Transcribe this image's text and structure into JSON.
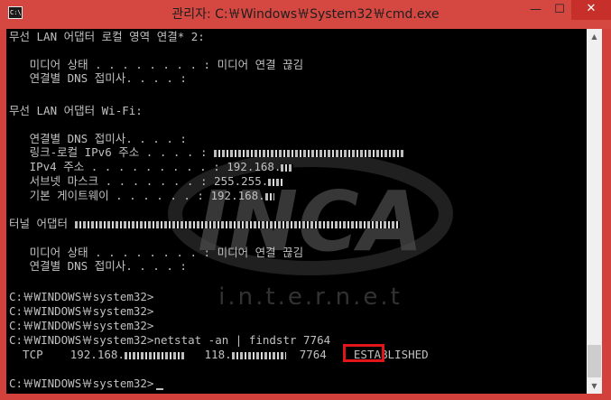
{
  "window": {
    "title": "관리자: C:￦Windows￦System32￦cmd.exe",
    "icon_label": "C:\\",
    "controls": {
      "minimize": "—",
      "maximize": "☐",
      "close": "✕"
    }
  },
  "console": {
    "lines": [
      "무선 LAN 어댑터 로컬 영역 연결* 2:",
      "",
      "   미디어 상태 . . . . . . . . : 미디어 연결 끊김",
      "   연결별 DNS 접미사. . . . :",
      "",
      "무선 LAN 어댑터 Wi-Fi:",
      "",
      "   연결별 DNS 접미사. . . . :",
      "   링크-로컬 IPv6 주소 . . . . :",
      "   IPv4 주소 . . . . . . . . . : 192.168.",
      "   서브넷 마스크 . . . . . . . : 255.255.",
      "   기본 게이트웨이 . . . . . . : 192.168.",
      "",
      "터널 어댑터",
      "",
      "   미디어 상태 . . . . . . . . : 미디어 연결 끊김",
      "   연결별 DNS 접미사. . . . :",
      "",
      "C:￦WINDOWS￦system32>",
      "C:￦WINDOWS￦system32>",
      "C:￦WINDOWS￦system32>",
      "C:￦WINDOWS￦system32>netstat -an | findstr 7764",
      "  TCP    192.168.",
      "",
      "C:￦WINDOWS￦system32>"
    ],
    "tcp_row": {
      "remote": "118.",
      "port": "7764",
      "state": "ESTABLISHED"
    }
  },
  "watermark": {
    "brand": "INCA",
    "tagline": "i.n.t.e.r.n.e.t"
  },
  "colors": {
    "frame": "#d2413c",
    "console_bg": "#000000",
    "console_text": "#c0c0c0",
    "highlight": "#e0161a"
  }
}
